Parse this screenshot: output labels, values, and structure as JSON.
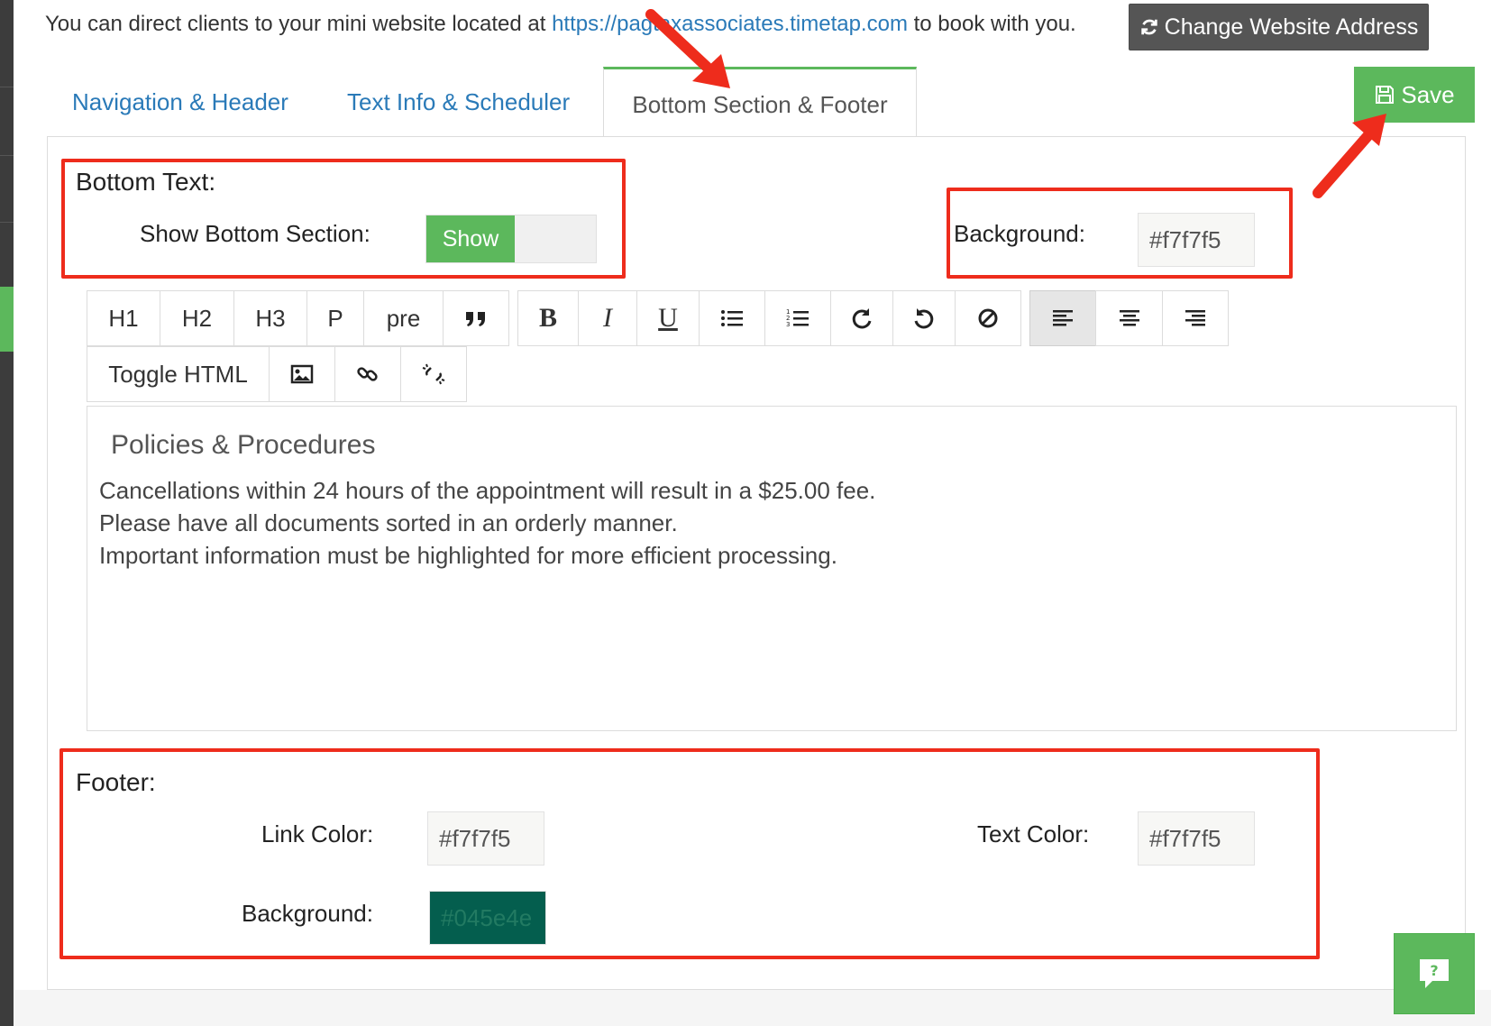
{
  "header": {
    "intro_text": "You can direct clients to your mini website located at ",
    "website_url": "https://pagtaxassociates.timetap.com",
    "outro_text": " to book with you.",
    "change_address_label": "Change Website Address"
  },
  "tabs": [
    {
      "label": "Navigation & Header"
    },
    {
      "label": "Text Info & Scheduler"
    },
    {
      "label": "Bottom Section & Footer"
    }
  ],
  "save_label": "Save",
  "bottom_text": {
    "title": "Bottom Text:",
    "show_label": "Show Bottom Section:",
    "show_on_label": "Show",
    "background_label": "Background:",
    "background_value": "#f7f7f5"
  },
  "toolbar": {
    "row1": [
      "H1",
      "H2",
      "H3",
      "P",
      "pre"
    ],
    "bold": "B",
    "italic": "I",
    "underline": "U",
    "toggle_html": "Toggle HTML",
    "icons": [
      "quote-icon",
      "bold-icon",
      "italic-icon",
      "underline-icon",
      "bullet-list-icon",
      "numbered-list-icon",
      "redo-icon",
      "undo-icon",
      "clear-format-icon",
      "align-left-icon",
      "align-center-icon",
      "align-right-icon",
      "image-icon",
      "link-icon",
      "unlink-icon"
    ]
  },
  "editor": {
    "heading": "Policies & Procedures",
    "lines": [
      "Cancellations within 24 hours of the appointment will result in a $25.00 fee.",
      "Please have all documents sorted in an orderly manner.",
      "Important information must be highlighted for more efficient processing."
    ]
  },
  "footer": {
    "title": "Footer:",
    "link_color_label": "Link Color:",
    "link_color_value": "#f7f7f5",
    "text_color_label": "Text Color:",
    "text_color_value": "#f7f7f5",
    "background_label": "Background:",
    "background_value": "#045e4e"
  },
  "colors": {
    "accent_green": "#5cb85c",
    "link_blue": "#2a7ab8",
    "annotation_red": "#ee2c1c",
    "dark_button": "#555555"
  }
}
